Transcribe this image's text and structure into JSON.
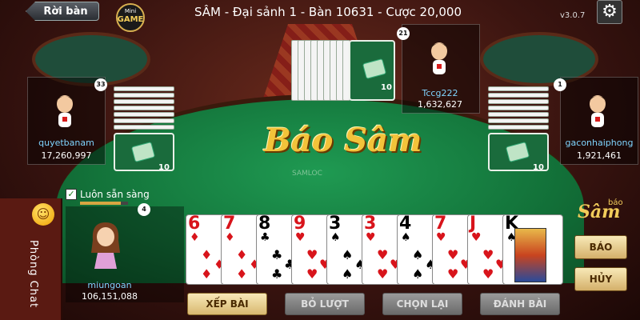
{
  "header": {
    "back_label": "Rời bàn",
    "logo_top": "Mini",
    "logo_main": "GAME",
    "title": "SÂM - Đại sảnh 1 - Bàn 10631 - Cược 20,000",
    "version": "v3.0.7"
  },
  "table": {
    "logo_text": "Báo Sâm",
    "logo_watermark": "SAMLOC"
  },
  "players": {
    "top": {
      "name": "Tccg222",
      "money": "1,632,627",
      "badge": "21",
      "cards": "10"
    },
    "left": {
      "name": "quyetbanam",
      "money": "17,260,997",
      "badge": "33",
      "cards": "10"
    },
    "right": {
      "name": "gaconhaiphong",
      "money": "1,921,461",
      "badge": "1",
      "cards": "10"
    },
    "me": {
      "name": "miungoan",
      "money": "106,151,088",
      "badge": "4"
    }
  },
  "ready": {
    "label": "Luôn sẵn sàng",
    "checked": true,
    "progress": 0.85
  },
  "chat": {
    "label": "Phòng Chat"
  },
  "hand": [
    {
      "rank": "6",
      "suit": "♦",
      "color": "red"
    },
    {
      "rank": "7",
      "suit": "♦",
      "color": "red"
    },
    {
      "rank": "8",
      "suit": "♣",
      "color": "black"
    },
    {
      "rank": "9",
      "suit": "♥",
      "color": "red"
    },
    {
      "rank": "3",
      "suit": "♠",
      "color": "black"
    },
    {
      "rank": "3",
      "suit": "♥",
      "color": "red"
    },
    {
      "rank": "4",
      "suit": "♠",
      "color": "black"
    },
    {
      "rank": "7",
      "suit": "♥",
      "color": "red"
    },
    {
      "rank": "J",
      "suit": "♥",
      "color": "red"
    },
    {
      "rank": "K",
      "suit": "♠",
      "color": "black"
    }
  ],
  "actions": {
    "sort": "XẾP BÀI",
    "skip": "BỎ LƯỢT",
    "reselect": "CHỌN LẠI",
    "play": "ĐÁNH BÀI",
    "report": "BÁO",
    "cancel": "HỦY"
  },
  "brand": {
    "main": "Sâm",
    "small": "báo"
  }
}
